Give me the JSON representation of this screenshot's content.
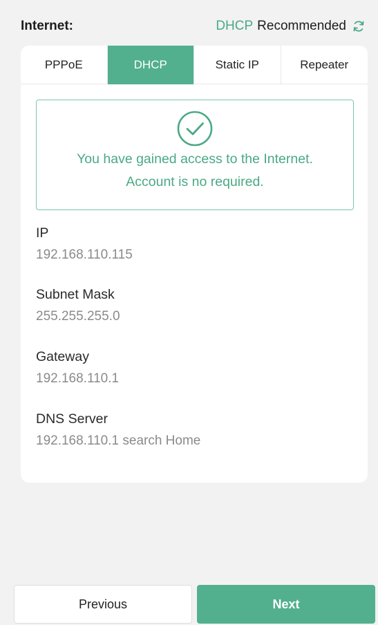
{
  "header": {
    "label": "Internet:",
    "mode": "DHCP",
    "recommended": "Recommended"
  },
  "tabs": [
    {
      "label": "PPPoE",
      "active": false
    },
    {
      "label": "DHCP",
      "active": true
    },
    {
      "label": "Static IP",
      "active": false
    },
    {
      "label": "Repeater",
      "active": false
    }
  ],
  "notice": {
    "line1": "You have gained access to the Internet.",
    "line2": "Account is no required."
  },
  "fields": [
    {
      "label": "IP",
      "value": "192.168.110.115"
    },
    {
      "label": "Subnet Mask",
      "value": "255.255.255.0"
    },
    {
      "label": "Gateway",
      "value": "192.168.110.1"
    },
    {
      "label": "DNS Server",
      "value": "192.168.110.1 search Home"
    }
  ],
  "footer": {
    "previous_label": "Previous",
    "next_label": "Next"
  },
  "colors": {
    "accent": "#52b08f",
    "accent_text": "#4aa985",
    "background": "#f2f2f3"
  },
  "icons": {
    "refresh": "refresh-icon",
    "success": "check-circle-icon"
  }
}
